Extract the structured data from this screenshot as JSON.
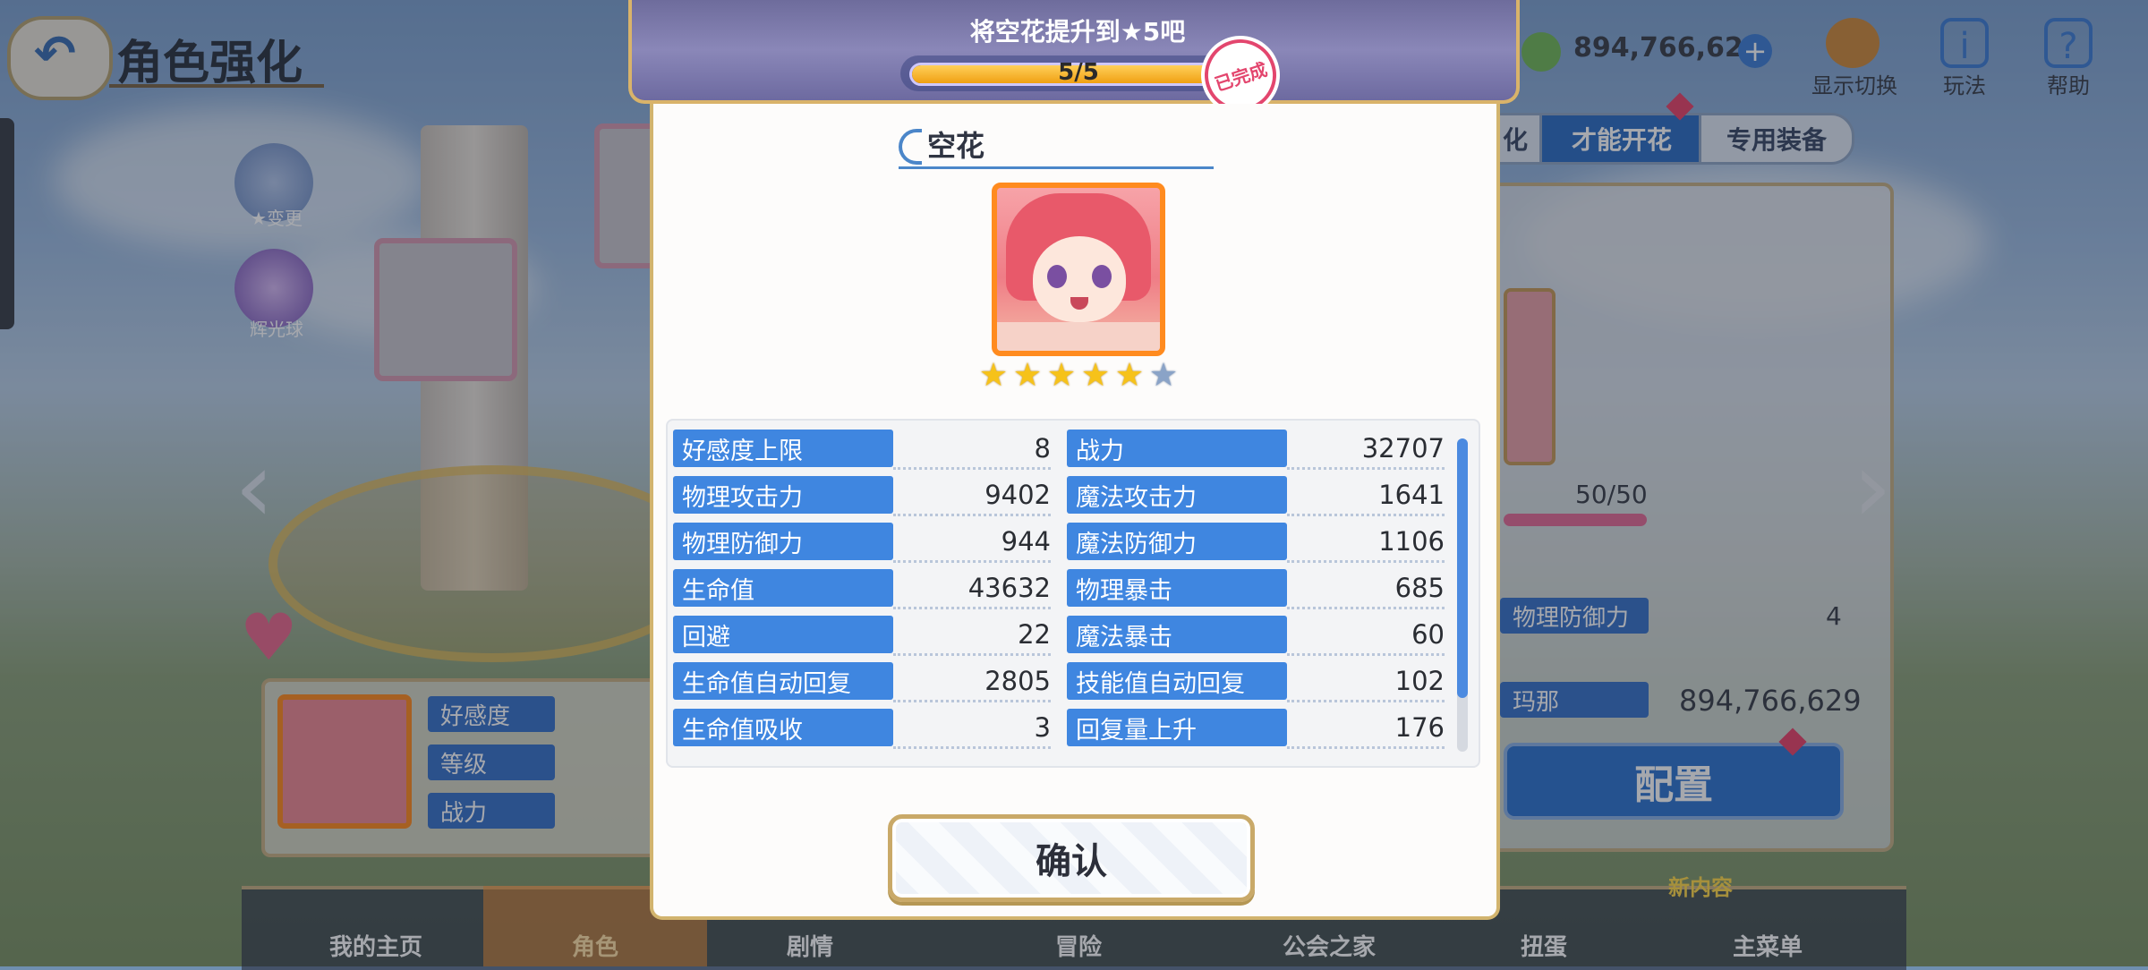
{
  "header": {
    "back_label": "",
    "title": "角色强化",
    "currency_value": "894,766,629",
    "display_toggle_label": "显示切换",
    "gameplay_label": "玩法",
    "help_label": "帮助"
  },
  "side_buttons": {
    "star_change": "★变更",
    "glow_orb": "辉光球"
  },
  "bg_tabs": [
    "化",
    "才能开花",
    "专用装备"
  ],
  "bg_panel": {
    "level_value": "50/50",
    "defense_label": "物理防御力",
    "defense_value": "4",
    "mana_label": "玛那",
    "mana_value": "894,766,629",
    "config_button": "配置"
  },
  "bg_info": {
    "affection": "好感度",
    "level": "等级",
    "power": "战力"
  },
  "bottom_nav": [
    "我的主页",
    "角色",
    "剧情",
    "冒险",
    "公会之家",
    "扭蛋",
    "主菜单"
  ],
  "new_content_badge": "新内容",
  "modal": {
    "title": "将空花提升到★5吧",
    "progress_text": "5/5",
    "progress_fraction": 1.0,
    "done_stamp": "已完成",
    "character_name": "空花",
    "stars_filled": 5,
    "stars_total": 6,
    "stats": [
      {
        "label": "好感度上限",
        "value": "8"
      },
      {
        "label": "战力",
        "value": "32707"
      },
      {
        "label": "物理攻击力",
        "value": "9402"
      },
      {
        "label": "魔法攻击力",
        "value": "1641"
      },
      {
        "label": "物理防御力",
        "value": "944"
      },
      {
        "label": "魔法防御力",
        "value": "1106"
      },
      {
        "label": "生命值",
        "value": "43632"
      },
      {
        "label": "物理暴击",
        "value": "685"
      },
      {
        "label": "回避",
        "value": "22"
      },
      {
        "label": "魔法暴击",
        "value": "60"
      },
      {
        "label": "生命值自动回复",
        "value": "2805"
      },
      {
        "label": "技能值自动回复",
        "value": "102"
      },
      {
        "label": "生命值吸收",
        "value": "3"
      },
      {
        "label": "回复量上升",
        "value": "176"
      }
    ],
    "confirm_label": "确认"
  },
  "colors": {
    "stat_label_bg": "#3f86e0",
    "accent_gold": "#d2b46e",
    "star_on": "#f6c21a",
    "star_off": "#8aa3c7",
    "done_stamp": "#e3466e"
  }
}
